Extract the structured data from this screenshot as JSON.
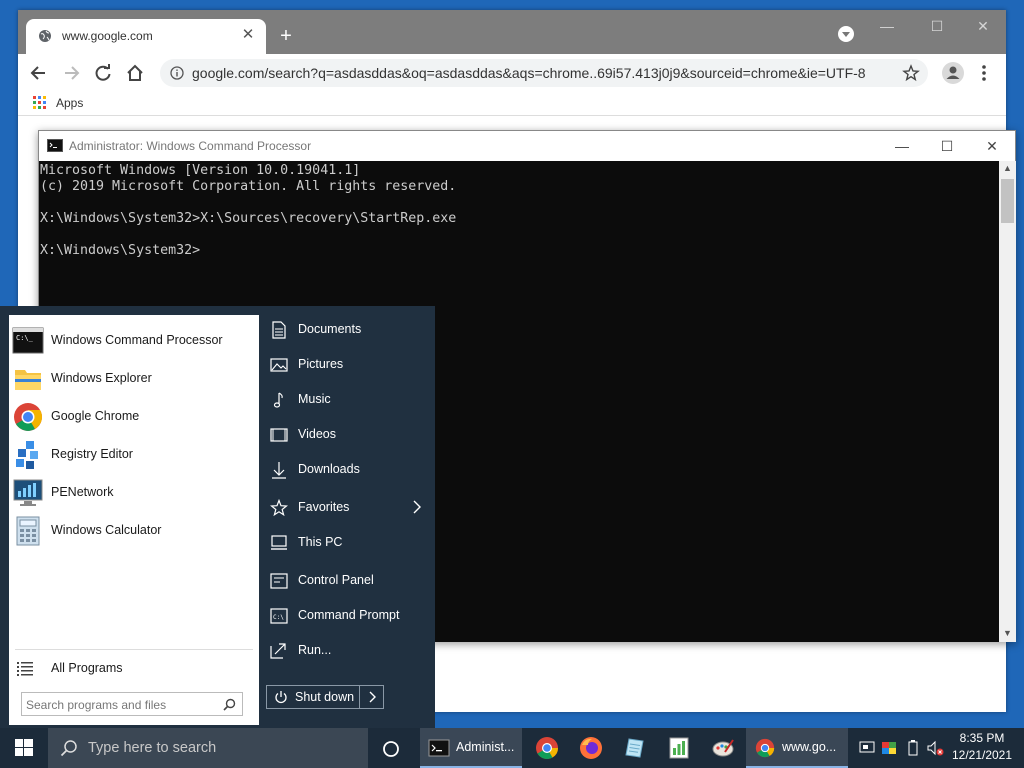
{
  "chrome": {
    "tab_title": "www.google.com",
    "url": "google.com/search?q=asdasddas&oq=asdasddas&aqs=chrome..69i57.413j0j9&sourceid=chrome&ie=UTF-8",
    "bookmarks": {
      "apps_label": "Apps"
    }
  },
  "cmd": {
    "title": "Administrator: Windows Command Processor",
    "console_lines": [
      "Microsoft Windows [Version 10.0.19041.1]",
      "(c) 2019 Microsoft Corporation. All rights reserved.",
      "",
      "X:\\Windows\\System32>X:\\Sources\\recovery\\StartRep.exe",
      "",
      "X:\\Windows\\System32>"
    ]
  },
  "start_menu": {
    "programs": [
      {
        "label": "Windows Command Processor",
        "icon": "cmd-icon"
      },
      {
        "label": "Windows Explorer",
        "icon": "folder-icon"
      },
      {
        "label": "Google Chrome",
        "icon": "chrome-icon"
      },
      {
        "label": "Registry Editor",
        "icon": "registry-icon"
      },
      {
        "label": "PENetwork",
        "icon": "network-icon"
      },
      {
        "label": "Windows Calculator",
        "icon": "calculator-icon"
      }
    ],
    "all_programs": "All Programs",
    "search_placeholder": "Search programs and files",
    "right_items": [
      {
        "label": "Documents",
        "icon": "document-icon"
      },
      {
        "label": "Pictures",
        "icon": "picture-icon"
      },
      {
        "label": "Music",
        "icon": "music-icon"
      },
      {
        "label": "Videos",
        "icon": "video-icon"
      },
      {
        "label": "Downloads",
        "icon": "download-icon"
      },
      {
        "label": "Favorites",
        "icon": "star-icon"
      },
      {
        "label": "This PC",
        "icon": "computer-icon"
      },
      {
        "label": "Control Panel",
        "icon": "control-panel-icon"
      },
      {
        "label": "Command Prompt",
        "icon": "command-prompt-icon"
      },
      {
        "label": "Run...",
        "icon": "run-icon"
      }
    ],
    "shutdown_label": "Shut down"
  },
  "taskbar": {
    "search_placeholder": "Type here to search",
    "cmd_item": "Administ...",
    "chrome_item": "www.go...",
    "time": "8:35 PM",
    "date": "12/21/2021"
  },
  "colors": {
    "desktop": "#1f67b8",
    "taskbar": "#1c2b3a",
    "start_menu_dark": "#203040",
    "console_bg": "#0c0c0c",
    "console_text": "#cccccc"
  }
}
